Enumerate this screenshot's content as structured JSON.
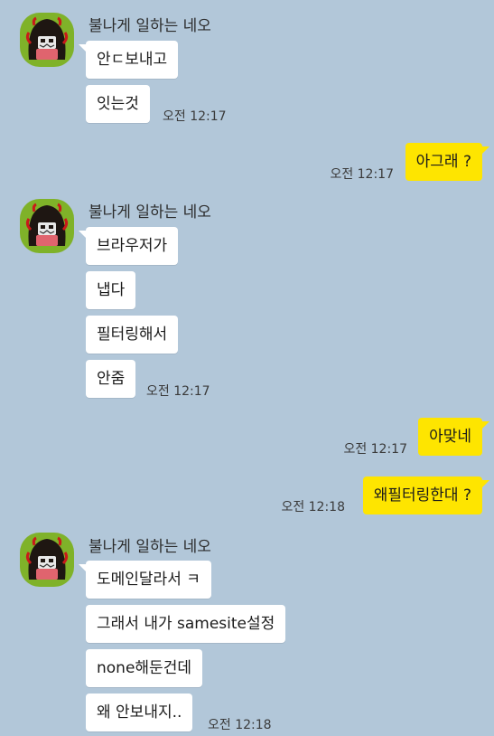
{
  "sender_name": "불나게 일하는 네오",
  "groups": [
    {
      "messages": [
        "안ㄷ보내고",
        "잇는것"
      ],
      "time": "오전 12:17"
    },
    {
      "messages": [
        "브라우저가",
        "냅다",
        "필터링해서",
        "안줌"
      ],
      "time": "오전 12:17"
    },
    {
      "messages": [
        "도메인달라서 ㅋ",
        "그래서 내가 samesite설정",
        "none해둔건데",
        "왜 안보내지.."
      ],
      "time": "오전 12:18"
    }
  ],
  "my_messages": [
    {
      "text": "아그래 ?",
      "time": "오전 12:17"
    },
    {
      "text": "아맞네",
      "time": "오전 12:17"
    },
    {
      "text": "왜필터링한대 ?",
      "time": "오전 12:18"
    }
  ],
  "colors": {
    "background": "#b2c7d9",
    "my_bubble": "#fee500",
    "their_bubble": "#ffffff",
    "avatar_bg": "#7fb229"
  },
  "icons": {
    "avatar": "neo-character-avatar"
  }
}
